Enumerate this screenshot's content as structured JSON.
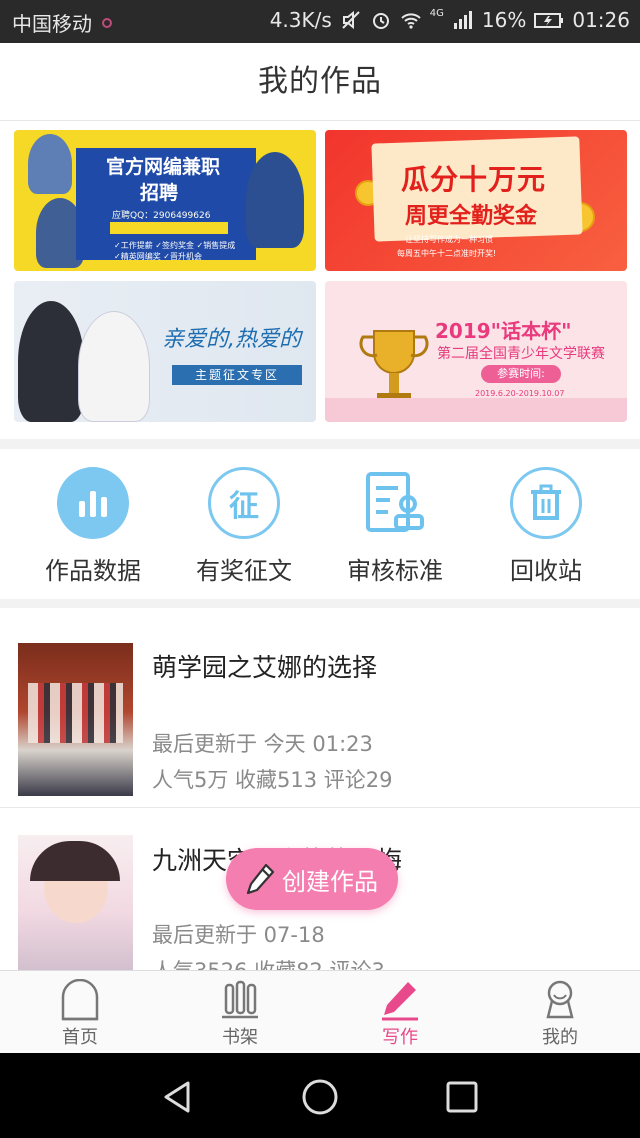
{
  "status_bar": {
    "carrier": "中国移动",
    "speed": "4.3K/s",
    "network": "4G",
    "battery": "16%",
    "time": "01:26"
  },
  "header": {
    "title": "我的作品"
  },
  "banners": [
    {
      "line1": "官方网编兼职",
      "line2": "招聘",
      "contact": "应聘QQ：2906499626",
      "checks": "✓工作提薪 ✓签约奖金 ✓销售提成 ✓精英网编奖 ✓晋升机会"
    },
    {
      "line1": "瓜分十万元",
      "line2": "周更全勤奖金",
      "line3": "让坚持写作成为一种习惯",
      "line4": "每周五中午十二点准时开奖!"
    },
    {
      "line1": "亲爱的,热爱的",
      "line2": "主题征文专区"
    },
    {
      "line1": "2019\"话本杯\"",
      "line2": "第二届全国青少年文学联赛",
      "line3": "参赛时间:",
      "line4": "2019.6.20-2019.10.07"
    }
  ],
  "actions": [
    {
      "label": "作品数据",
      "icon": "bar-chart-icon"
    },
    {
      "label": "有奖征文",
      "icon": "zheng-badge-icon"
    },
    {
      "label": "审核标准",
      "icon": "review-document-icon"
    },
    {
      "label": "回收站",
      "icon": "trash-icon"
    }
  ],
  "works": [
    {
      "title": "萌学园之艾娜的选择",
      "updated": "最后更新于 今天 01:23",
      "stats": "人气5万 收藏513 评论29"
    },
    {
      "title": "九洲天空城之执执无悔",
      "updated": "最后更新于 07-18",
      "stats": "人气3526 收藏82 评论3"
    }
  ],
  "fab": {
    "label": "创建作品"
  },
  "tabs": [
    {
      "label": "首页",
      "active": false
    },
    {
      "label": "书架",
      "active": false
    },
    {
      "label": "写作",
      "active": true
    },
    {
      "label": "我的",
      "active": false
    }
  ],
  "colors": {
    "accent": "#e8498a",
    "icon_blue": "#6ec2ee",
    "fab": "#f57eb1"
  }
}
